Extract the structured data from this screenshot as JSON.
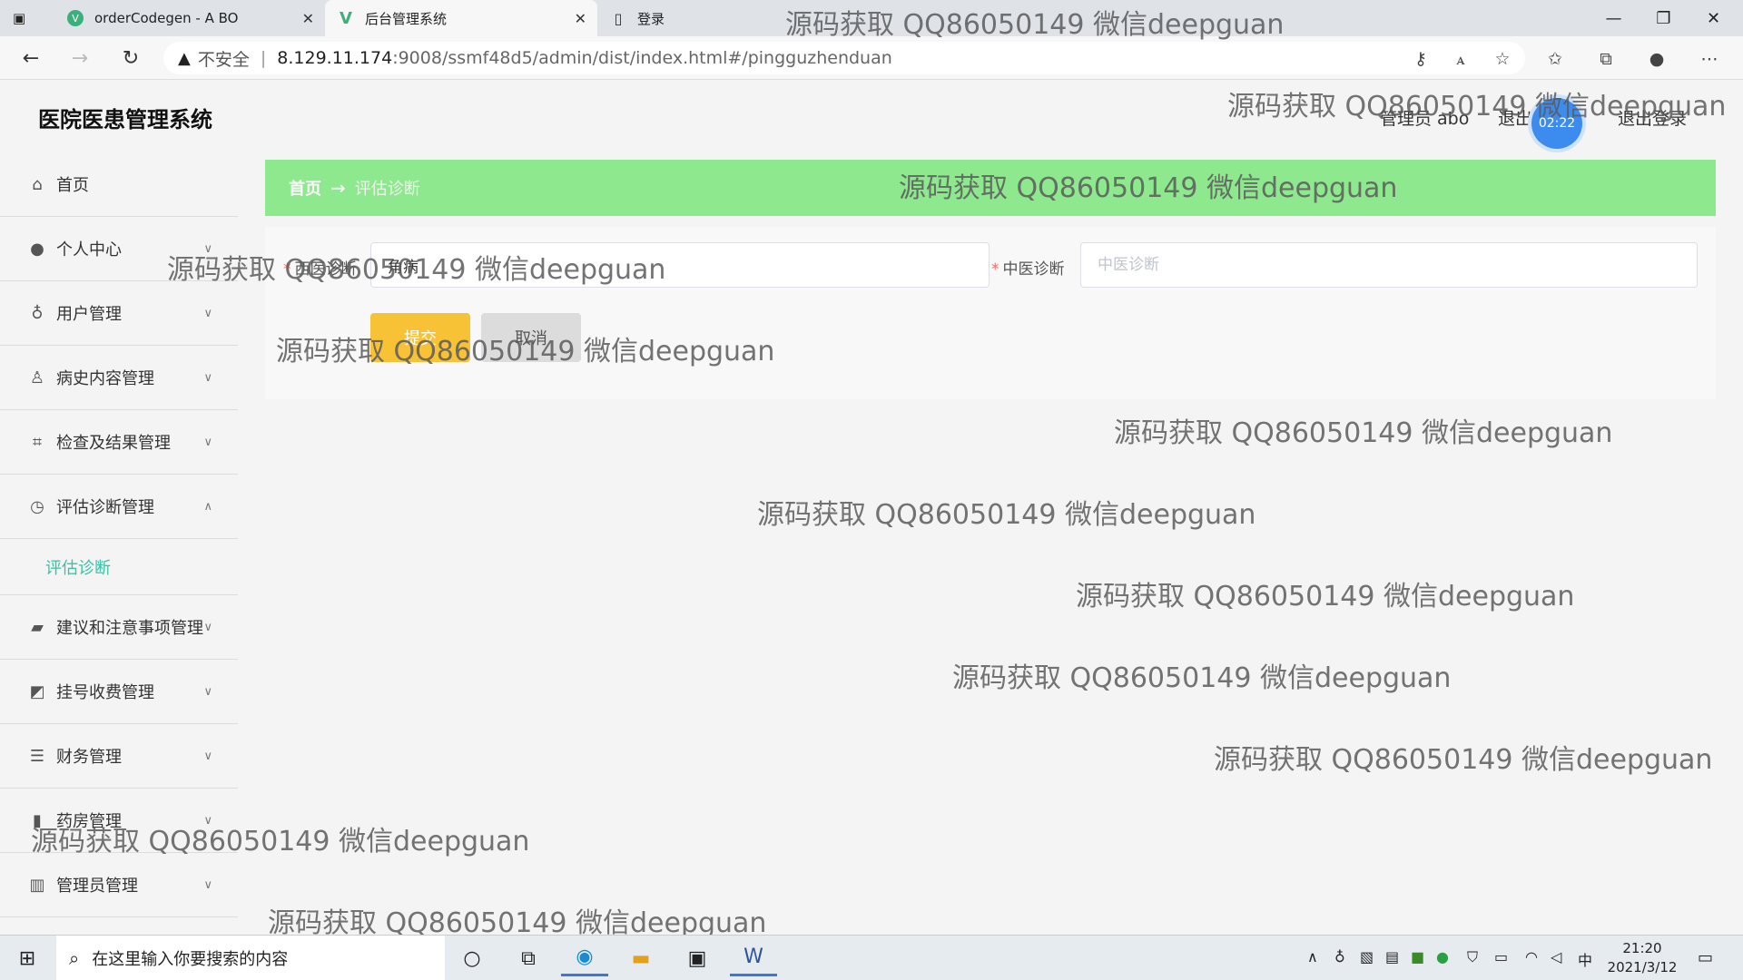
{
  "browser": {
    "tabs": [
      {
        "title": "orderCodegen - A BO",
        "icon": "vue-icon"
      },
      {
        "title": "后台管理系统",
        "icon": "vue-icon"
      },
      {
        "title": "登录",
        "icon": "page-icon"
      }
    ],
    "security_label": "不安全",
    "url_host": "8.129.11.174",
    "url_rest": ":9008/ssmf48d5/admin/dist/index.html#/pingguzhenduan"
  },
  "app": {
    "title": "医院医患管理系统",
    "user_label": "管理员 abo",
    "exit_system": "退出到前台",
    "logout": "退出登录",
    "clock": "02:22"
  },
  "sidebar": {
    "items": [
      {
        "label": "首页",
        "icon": "home-icon"
      },
      {
        "label": "个人中心",
        "icon": "user-icon"
      },
      {
        "label": "用户管理",
        "icon": "mic-icon"
      },
      {
        "label": "病史内容管理",
        "icon": "person-icon"
      },
      {
        "label": "检查及结果管理",
        "icon": "crop-icon"
      },
      {
        "label": "评估诊断管理",
        "icon": "clock-icon"
      },
      {
        "label": "建议和注意事项管理",
        "icon": "briefcase-icon"
      },
      {
        "label": "挂号收费管理",
        "icon": "chart-icon"
      },
      {
        "label": "财务管理",
        "icon": "list-icon"
      },
      {
        "label": "药房管理",
        "icon": "book-icon"
      },
      {
        "label": "管理员管理",
        "icon": "bar-icon"
      }
    ],
    "submenu_label": "评估诊断"
  },
  "breadcrumb": {
    "home": "首页",
    "arrow": "→",
    "current": "评估诊断"
  },
  "form": {
    "western_label": "西医诊断",
    "western_value": "角病",
    "chinese_label": "中医诊断",
    "chinese_placeholder": "中医诊断",
    "submit_label": "提交",
    "cancel_label": "取消"
  },
  "watermark": "源码获取 QQ86050149 微信deepguan",
  "taskbar": {
    "search_placeholder": "在这里输入你要搜索的内容",
    "time": "21:20",
    "date": "2021/3/12",
    "ime": "中"
  }
}
